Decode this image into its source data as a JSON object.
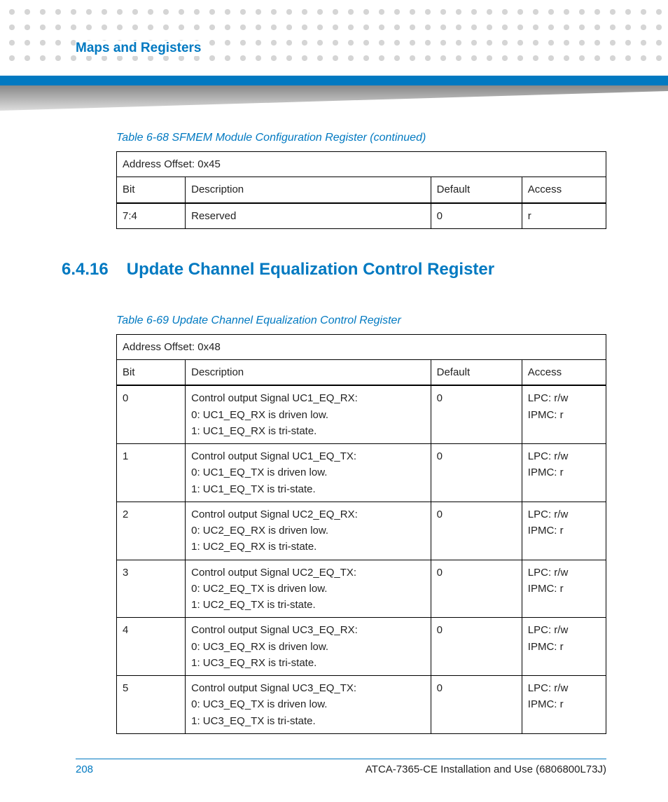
{
  "header": {
    "chapter_title": "Maps and Registers"
  },
  "table68": {
    "caption": "Table 6-68 SFMEM Module Configuration Register (continued)",
    "address_offset": "Address Offset: 0x45",
    "columns": {
      "bit": "Bit",
      "description": "Description",
      "default": "Default",
      "access": "Access"
    },
    "rows": [
      {
        "bit": "7:4",
        "description": [
          "Reserved"
        ],
        "default": "0",
        "access": [
          "r"
        ]
      }
    ]
  },
  "section": {
    "number": "6.4.16",
    "title": "Update Channel Equalization Control Register"
  },
  "table69": {
    "caption": "Table 6-69 Update Channel Equalization Control Register",
    "address_offset": "Address Offset: 0x48",
    "columns": {
      "bit": "Bit",
      "description": "Description",
      "default": "Default",
      "access": "Access"
    },
    "rows": [
      {
        "bit": "0",
        "description": [
          "Control output Signal UC1_EQ_RX:",
          "0: UC1_EQ_RX is driven low.",
          "1: UC1_EQ_RX is tri-state."
        ],
        "default": "0",
        "access": [
          "LPC: r/w",
          "IPMC: r"
        ]
      },
      {
        "bit": "1",
        "description": [
          "Control output Signal UC1_EQ_TX:",
          "0: UC1_EQ_TX is driven low.",
          "1: UC1_EQ_TX is tri-state."
        ],
        "default": "0",
        "access": [
          "LPC: r/w",
          "IPMC: r"
        ]
      },
      {
        "bit": "2",
        "description": [
          "Control output Signal UC2_EQ_RX:",
          "0: UC2_EQ_RX is driven low.",
          "1: UC2_EQ_RX is tri-state."
        ],
        "default": "0",
        "access": [
          "LPC: r/w",
          "IPMC: r"
        ]
      },
      {
        "bit": "3",
        "description": [
          "Control output Signal UC2_EQ_TX:",
          "0: UC2_EQ_TX is driven low.",
          "1: UC2_EQ_TX is tri-state."
        ],
        "default": "0",
        "access": [
          "LPC: r/w",
          "IPMC: r"
        ]
      },
      {
        "bit": "4",
        "description": [
          "Control output Signal UC3_EQ_RX:",
          "0: UC3_EQ_RX is driven low.",
          "1: UC3_EQ_RX is tri-state."
        ],
        "default": "0",
        "access": [
          "LPC: r/w",
          "IPMC: r"
        ]
      },
      {
        "bit": "5",
        "description": [
          "Control output Signal UC3_EQ_TX:",
          "0: UC3_EQ_TX is driven low.",
          "1: UC3_EQ_TX is tri-state."
        ],
        "default": "0",
        "access": [
          "LPC: r/w",
          "IPMC: r"
        ]
      }
    ]
  },
  "footer": {
    "page": "208",
    "doc": "ATCA-7365-CE Installation and Use (6806800L73J)"
  }
}
